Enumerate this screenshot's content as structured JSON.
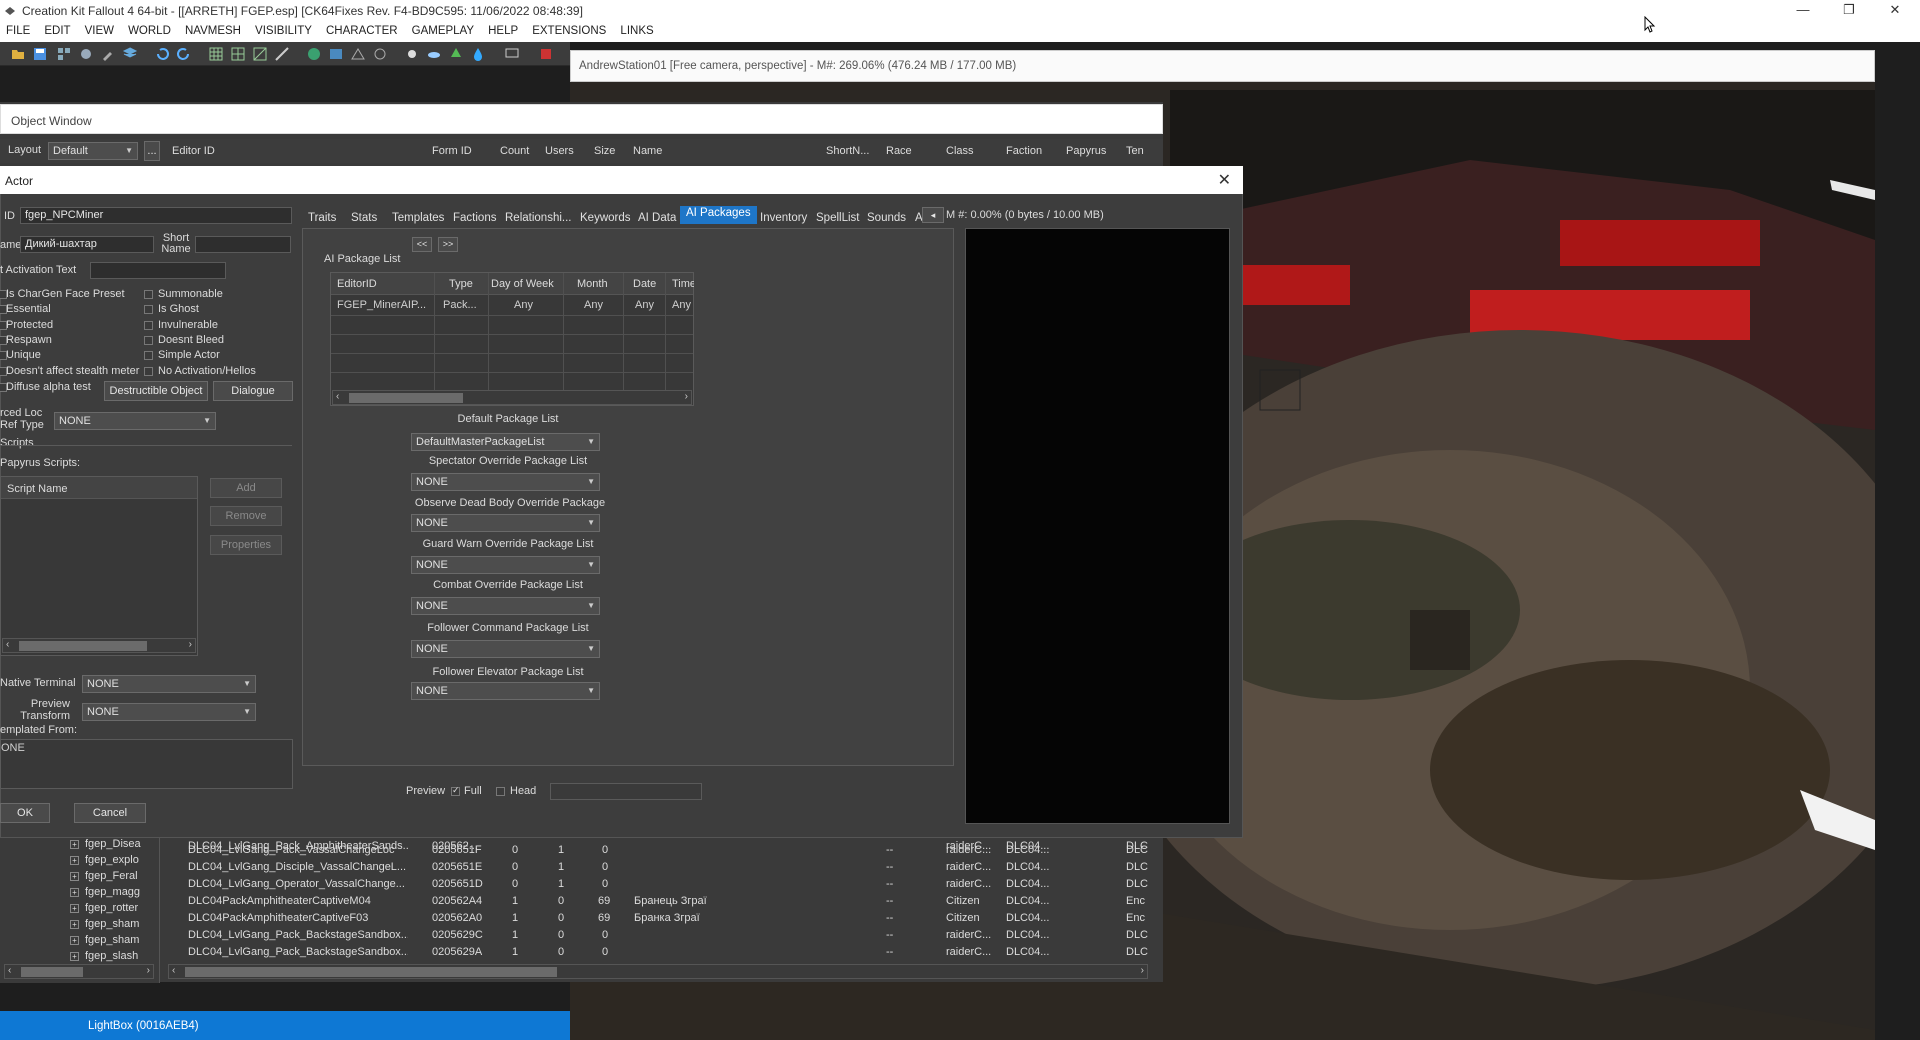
{
  "app": {
    "title": "Creation Kit Fallout 4 64-bit - [[ARRETH] FGEP.esp] [CK64Fixes Rev. F4-BD9C595: 11/06/2022 08:48:39]",
    "min": "—",
    "max": "❐",
    "close": "✕"
  },
  "menu": [
    "FILE",
    "EDIT",
    "VIEW",
    "WORLD",
    "NAVMESH",
    "VISIBILITY",
    "CHARACTER",
    "GAMEPLAY",
    "HELP",
    "EXTENSIONS",
    "LINKS"
  ],
  "viewport": {
    "title": "AndrewStation01 [Free camera, perspective] - M#: 269.06% (476.24 MB / 177.00 MB)"
  },
  "object_window": {
    "title": "Object Window",
    "layout_label": "Layout",
    "layout_value": "Default",
    "more": "...",
    "columns": [
      "Editor ID",
      "Form ID",
      "Count",
      "Users",
      "Size",
      "Name",
      "ShortN...",
      "Race",
      "Class",
      "Faction",
      "Papyrus",
      "Ten"
    ],
    "tree": [
      "fgep_Disea",
      "fgep_explo",
      "fgep_Feral",
      "fgep_magg",
      "fgep_rotter",
      "fgep_sham",
      "fgep_sham",
      "fgep_slash"
    ],
    "rows": [
      {
        "editor_id": "DLC04_LvlGang_Pack_AmphitheaterSands...",
        "form_id": "020562...",
        "count": "",
        "users": "",
        "size": "",
        "name": "",
        "shortn": "",
        "race": "",
        "class": "raiderC...",
        "faction": "DLC04...",
        "papyrus": "",
        "ten": "DLC"
      },
      {
        "editor_id": "DLC04_LvlGang_Pack_VassalChangeLoc",
        "form_id": "0205651F",
        "count": "0",
        "users": "1",
        "size": "0",
        "name": "",
        "shortn": "--",
        "race": "",
        "class": "raiderC...",
        "faction": "DLC04...",
        "papyrus": "",
        "ten": "DLC"
      },
      {
        "editor_id": "DLC04_LvlGang_Disciple_VassalChangeL...",
        "form_id": "0205651E",
        "count": "0",
        "users": "1",
        "size": "0",
        "name": "",
        "shortn": "--",
        "race": "",
        "class": "raiderC...",
        "faction": "DLC04...",
        "papyrus": "",
        "ten": "DLC"
      },
      {
        "editor_id": "DLC04_LvlGang_Operator_VassalChange...",
        "form_id": "0205651D",
        "count": "0",
        "users": "1",
        "size": "0",
        "name": "",
        "shortn": "--",
        "race": "",
        "class": "raiderC...",
        "faction": "DLC04...",
        "papyrus": "",
        "ten": "DLC"
      },
      {
        "editor_id": "DLC04PackAmphitheaterCaptiveM04",
        "form_id": "020562A4",
        "count": "1",
        "users": "0",
        "size": "69",
        "name": "Бранець Зграї",
        "shortn": "--",
        "race": "",
        "class": "Citizen",
        "faction": "DLC04...",
        "papyrus": "",
        "ten": "Enc"
      },
      {
        "editor_id": "DLC04PackAmphitheaterCaptiveF03",
        "form_id": "020562A0",
        "count": "1",
        "users": "0",
        "size": "69",
        "name": "Бранка Зграї",
        "shortn": "--",
        "race": "",
        "class": "Citizen",
        "faction": "DLC04...",
        "papyrus": "",
        "ten": "Enc"
      },
      {
        "editor_id": "DLC04_LvlGang_Pack_BackstageSandbox...",
        "form_id": "0205629C",
        "count": "1",
        "users": "0",
        "size": "0",
        "name": "",
        "shortn": "--",
        "race": "",
        "class": "raiderC...",
        "faction": "DLC04...",
        "papyrus": "",
        "ten": "DLC"
      },
      {
        "editor_id": "DLC04_LvlGang_Pack_BackstageSandbox...",
        "form_id": "0205629A",
        "count": "1",
        "users": "0",
        "size": "0",
        "name": "",
        "shortn": "--",
        "race": "",
        "class": "raiderC...",
        "faction": "DLC04...",
        "papyrus": "",
        "ten": "DLC"
      }
    ]
  },
  "actor": {
    "title": "Actor",
    "id_label": "ID",
    "id_value": "fgep_NPCMiner",
    "name_label": "ame",
    "name_value": "Дикий-шахтар",
    "short_name_label": "Short Name",
    "activation_text_label": "t Activation Text",
    "flags_left": [
      "Is CharGen Face Preset",
      "Essential",
      "Protected",
      "Respawn",
      "Unique",
      "Doesn't affect stealth meter",
      "Diffuse alpha test"
    ],
    "flags_right": [
      "Summonable",
      "Is Ghost",
      "Invulnerable",
      "Doesnt Bleed",
      "Simple Actor",
      "No Activation/Hellos"
    ],
    "destructible_btn": "Destructible Object",
    "dialogue_btn": "Dialogue",
    "forced_loc_label": "rced Loc Ref Type",
    "forced_loc_value": "NONE",
    "scripts_label": "Scripts",
    "papyrus_scripts_label": "Papyrus Scripts:",
    "script_name_header": "Script Name",
    "add_btn": "Add",
    "remove_btn": "Remove",
    "properties_btn": "Properties",
    "native_terminal_label": "Native Terminal",
    "native_terminal_value": "NONE",
    "preview_transform_label": "Preview Transform",
    "preview_transform_value": "NONE",
    "templated_from_label": "emplated From:",
    "templated_from_value": "ONE",
    "ok_btn": "OK",
    "cancel_btn": "Cancel",
    "tabs": [
      "Traits",
      "Stats",
      "Templates",
      "Factions",
      "Relationshi...",
      "Keywords",
      "AI Data",
      "AI Packages",
      "Inventory",
      "SpellList",
      "Sounds",
      "A"
    ],
    "active_tab": "AI Packages",
    "nav_prev": "<<",
    "nav_next": ">>",
    "ai_package_list_label": "AI Package List",
    "pkg_columns": [
      "EditorID",
      "Type",
      "Day of Week",
      "Month",
      "Date",
      "Time"
    ],
    "pkg_rows": [
      {
        "editor_id": "FGEP_MinerAIP...",
        "type": "Pack...",
        "day": "Any",
        "month": "Any",
        "date": "Any",
        "time": "Any"
      }
    ],
    "lists": [
      {
        "label": "Default Package List",
        "value": "DefaultMasterPackageList"
      },
      {
        "label": "Spectator Override Package List",
        "value": "NONE"
      },
      {
        "label": "Observe Dead Body Override Package",
        "value": "NONE"
      },
      {
        "label": "Guard Warn Override Package List",
        "value": "NONE"
      },
      {
        "label": "Combat Override Package List",
        "value": "NONE"
      },
      {
        "label": "Follower Command Package List",
        "value": "NONE"
      },
      {
        "label": "Follower Elevator Package List",
        "value": "NONE"
      }
    ],
    "preview_label": "Preview",
    "full_label": "Full",
    "head_label": "Head",
    "memory_label": "M #: 0.00% (0 bytes / 10.00 MB)"
  },
  "status": {
    "text": "LightBox (0016AEB4)"
  }
}
